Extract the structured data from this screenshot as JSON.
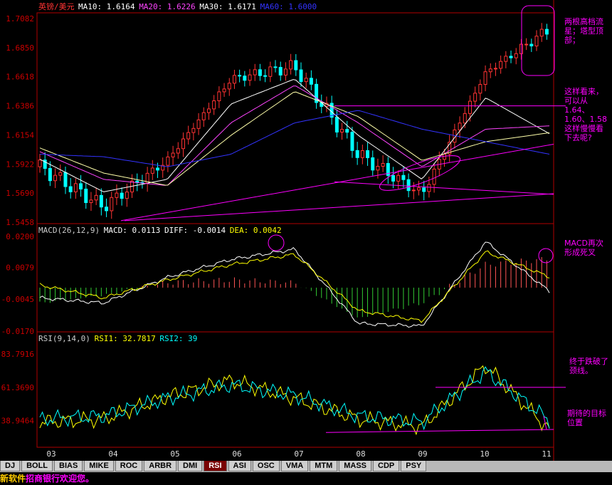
{
  "panels": {
    "price": {
      "title": "英镑/美元",
      "ma_labels": [
        {
          "text": "MA10: 1.6164",
          "color": "#ffffff"
        },
        {
          "text": "MA20: 1.6226",
          "color": "#ff44ff"
        },
        {
          "text": "MA30: 1.6171",
          "color": "#ffffff"
        },
        {
          "text": "MA60: 1.6000",
          "color": "#3333ff"
        }
      ],
      "ylabels": [
        "1.7082",
        "1.6850",
        "1.6618",
        "1.6386",
        "1.6154",
        "1.5922",
        "1.5690",
        "1.5458"
      ]
    },
    "macd": {
      "labels": [
        {
          "text": "MACD(26,12,9)",
          "color": "#cccccc"
        },
        {
          "text": "MACD: 0.0113",
          "color": "#ffffff"
        },
        {
          "text": "DIFF: -0.0014",
          "color": "#ffffff"
        },
        {
          "text": "DEA: 0.0042",
          "color": "#ffff00"
        }
      ],
      "ylabels": [
        "0.0200",
        "0.0079",
        "-0.0045",
        "-0.0170"
      ]
    },
    "rsi": {
      "labels": [
        {
          "text": "RSI(9,14,0)",
          "color": "#cccccc"
        },
        {
          "text": "RSI1: 32.7817",
          "color": "#ffff00"
        },
        {
          "text": "RSI2: 39",
          "color": "#00ffff"
        }
      ],
      "ylabels": [
        "83.7916",
        "61.3690",
        "38.9464"
      ]
    }
  },
  "x_axis": [
    "03",
    "04",
    "05",
    "06",
    "07",
    "08",
    "09",
    "10",
    "11"
  ],
  "annotations": {
    "top": "两根高档流星；塔型顶部；",
    "support": "这样看来，可以从1.64、1.60、1.58这样慢慢看下去呢?",
    "macd": "MACD再次形成死叉",
    "neckline": "终于跌破了颈线。",
    "target": "期待的目标位置"
  },
  "tabs": [
    "DJ",
    "BOLL",
    "BIAS",
    "MIKE",
    "ROC",
    "ARBR",
    "DMI",
    "RSI",
    "ASI",
    "OSC",
    "VMA",
    "MTM",
    "MASS",
    "CDP",
    "PSY"
  ],
  "active_tab": "RSI",
  "status": {
    "prefix": "新软件",
    "text": "招商银行欢迎您。"
  },
  "chart_data": [
    {
      "type": "line",
      "title": "英镑/美元",
      "x": [
        "03",
        "04",
        "05",
        "06",
        "07",
        "08",
        "09",
        "10",
        "11"
      ],
      "series": [
        {
          "name": "Close",
          "values": [
            1.59,
            1.558,
            1.595,
            1.66,
            1.67,
            1.6,
            1.568,
            1.665,
            1.7
          ]
        },
        {
          "name": "MA10",
          "values": [
            1.596,
            1.57,
            1.58,
            1.64,
            1.66,
            1.615,
            1.58,
            1.645,
            1.6164
          ]
        },
        {
          "name": "MA20",
          "values": [
            1.602,
            1.58,
            1.575,
            1.625,
            1.655,
            1.625,
            1.59,
            1.62,
            1.6226
          ]
        },
        {
          "name": "MA30",
          "values": [
            1.605,
            1.585,
            1.575,
            1.615,
            1.65,
            1.63,
            1.595,
            1.61,
            1.6171
          ]
        },
        {
          "name": "MA60",
          "values": [
            1.6,
            1.598,
            1.59,
            1.6,
            1.625,
            1.635,
            1.62,
            1.61,
            1.6
          ]
        }
      ],
      "ylim": [
        1.5458,
        1.7082
      ]
    },
    {
      "type": "bar",
      "title": "MACD(26,12,9)",
      "x": [
        "03",
        "04",
        "05",
        "06",
        "07",
        "08",
        "09",
        "10",
        "11"
      ],
      "series": [
        {
          "name": "MACD",
          "values": [
            -0.006,
            -0.003,
            0.002,
            0.003,
            0.002,
            -0.012,
            -0.006,
            0.009,
            0.0113
          ]
        },
        {
          "name": "DIFF",
          "values": [
            -0.004,
            -0.006,
            0.004,
            0.011,
            0.015,
            -0.014,
            -0.015,
            0.018,
            -0.0014
          ]
        },
        {
          "name": "DEA",
          "values": [
            0.001,
            -0.004,
            0.003,
            0.009,
            0.013,
            -0.009,
            -0.013,
            0.014,
            0.0042
          ]
        }
      ],
      "ylim": [
        -0.017,
        0.02
      ]
    },
    {
      "type": "line",
      "title": "RSI(9,14,0)",
      "x": [
        "03",
        "04",
        "05",
        "06",
        "07",
        "08",
        "09",
        "10",
        "11"
      ],
      "series": [
        {
          "name": "RSI1",
          "values": [
            38,
            40,
            55,
            66,
            54,
            40,
            35,
            76,
            32.7817
          ]
        },
        {
          "name": "RSI2",
          "values": [
            40,
            42,
            54,
            63,
            56,
            42,
            38,
            72,
            39
          ]
        }
      ],
      "ylim": [
        22,
        90
      ]
    }
  ]
}
